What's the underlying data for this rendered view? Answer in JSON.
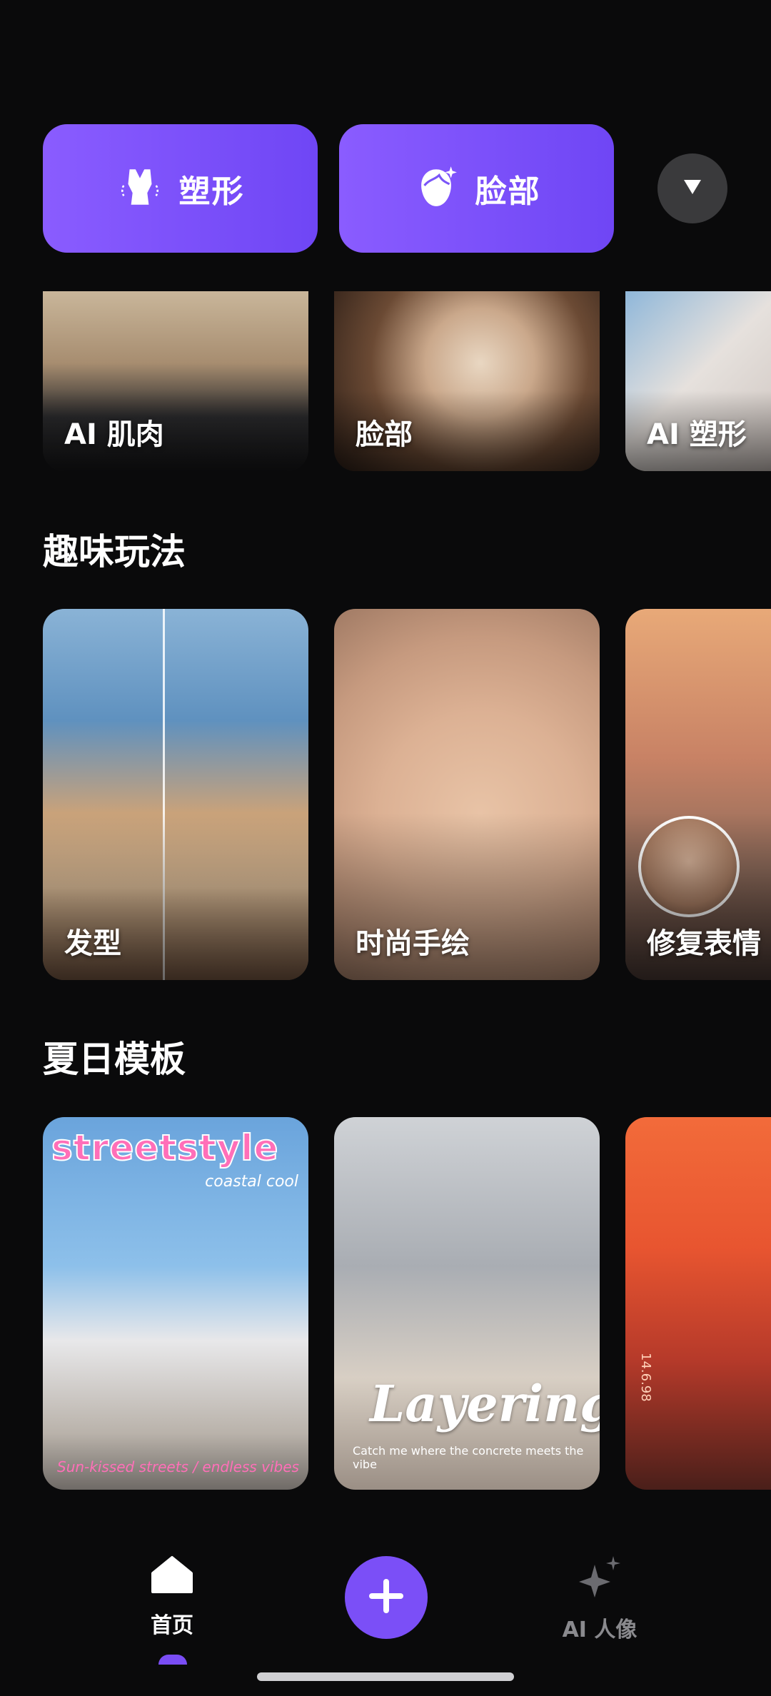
{
  "top_categories": [
    {
      "label": "塑形",
      "icon": "bodysuit-icon"
    },
    {
      "label": "脸部",
      "icon": "face-sparkle-icon"
    }
  ],
  "more_button": {
    "icon": "triangle-down-icon"
  },
  "row_body": [
    {
      "title": "AI 肌肉"
    },
    {
      "title": "脸部"
    },
    {
      "title": "AI 塑形"
    }
  ],
  "section_fun": {
    "title": "趣味玩法",
    "cards": [
      {
        "title": "发型"
      },
      {
        "title": "时尚手绘"
      },
      {
        "title": "修复表情"
      }
    ]
  },
  "section_summer": {
    "title": "夏日模板",
    "cards": [
      {
        "headline": "streetstyle",
        "sub": "coastal cool",
        "foot": "Sun-kissed streets / endless vibes"
      },
      {
        "headline": "Layering.",
        "sub": "Catch me where the concrete meets the vibe"
      },
      {
        "side_text": "14.6.98"
      }
    ]
  },
  "bottom_nav": {
    "home_label": "首页",
    "ai_label": "AI 人像",
    "accent": "#7b4ff7"
  }
}
